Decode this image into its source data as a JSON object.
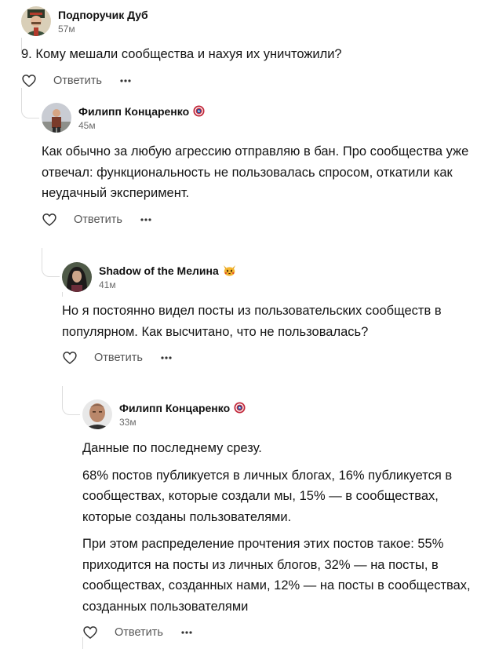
{
  "comments": [
    {
      "author": "Подпоручик Дуб",
      "time": "57м",
      "paragraphs": [
        "9. Кому мешали сообщества и нахуя их уничтожили?"
      ],
      "reply_label": "Ответить"
    },
    {
      "author": "Филипп Концаренко",
      "time": "45м",
      "badge_icon": "shield-badge-icon",
      "paragraphs": [
        "Как обычно за любую агрессию отправляю в бан. Про сообщества уже отвечал: функциональность не пользовалась спросом, откатили как неудачный эксперимент."
      ],
      "reply_label": "Ответить"
    },
    {
      "author": "Shadow of the Мелина",
      "time": "41м",
      "badge_icon": "pikachu-emoji-icon",
      "paragraphs": [
        "Но я постоянно видел посты из пользовательских сообществ в популярном. Как высчитано, что не пользовалась?"
      ],
      "reply_label": "Ответить"
    },
    {
      "author": "Филипп Концаренко",
      "time": "33м",
      "badge_icon": "shield-badge-icon",
      "paragraphs": [
        "Данные по последнему срезу.",
        "68% постов публикуется в личных блогах, 16% публикуется в сообществах, которые создали мы, 15% — в сообществах, которые созданы пользователями.",
        "При этом распределение прочтения этих постов такое: 55% приходится на посты из личных блогов, 32% — на посты, в сообществах, созданных нами, 12% — на посты в сообществах, созданных пользователями"
      ],
      "reply_label": "Ответить"
    }
  ],
  "colors": {
    "text": "#141414",
    "muted": "#6b6b6b",
    "thread_line": "#dcdcdc"
  },
  "icons": [
    "heart-icon",
    "more-dots-icon",
    "shield-badge-icon",
    "pikachu-emoji-icon"
  ]
}
